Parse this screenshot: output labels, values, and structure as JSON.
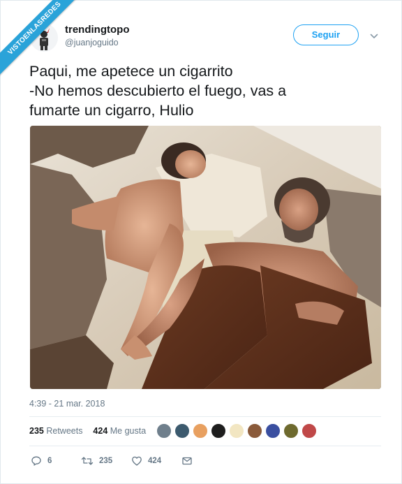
{
  "watermark": {
    "text": "VISTOENLASREDES"
  },
  "user": {
    "name": "trendingtopo",
    "handle": "@juanjoguido",
    "avatar_icon": "devil-figure-avatar"
  },
  "follow_button": {
    "label": "Seguir"
  },
  "menu_icon": "chevron-down-icon",
  "tweet": {
    "text": "Paqui, me apetece un cigarrito\n-No hemos descubierto el fuego, vas a\nfumarte un cigarro, Hulio",
    "timestamp": "4:39 - 21 mar. 2018",
    "photo_icon": "cavemen-photo"
  },
  "stats": {
    "retweets_count": "235",
    "retweets_label": "Retweets",
    "likes_count": "424",
    "likes_label": "Me gusta"
  },
  "actions": {
    "reply_count": "6",
    "retweet_count": "235",
    "like_count": "424"
  },
  "colors": {
    "accent": "#1da1f2",
    "secondary_text": "#657786",
    "watermark": "#2aa3d9"
  }
}
